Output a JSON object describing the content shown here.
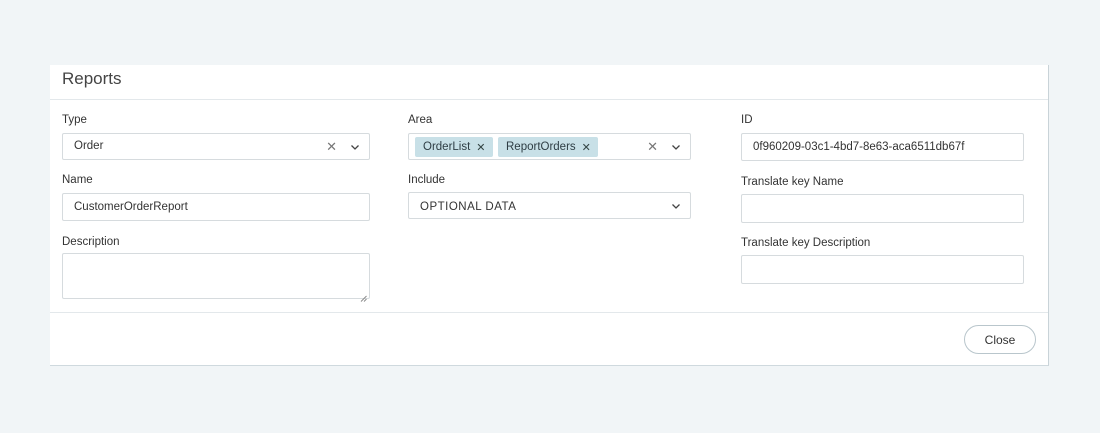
{
  "dialog": {
    "title": "Reports",
    "close_label": "Close"
  },
  "form": {
    "type": {
      "label": "Type",
      "value": "Order"
    },
    "area": {
      "label": "Area",
      "tags": [
        "OrderList",
        "ReportOrders"
      ]
    },
    "id": {
      "label": "ID",
      "value": "0f960209-03c1-4bd7-8e63-aca6511db67f"
    },
    "name": {
      "label": "Name",
      "value": "CustomerOrderReport"
    },
    "include": {
      "label": "Include",
      "placeholder": "OPTIONAL DATA"
    },
    "translate_key_name": {
      "label": "Translate key Name",
      "value": ""
    },
    "description": {
      "label": "Description",
      "value": ""
    },
    "translate_key_description": {
      "label": "Translate key Description",
      "value": ""
    }
  },
  "icons": {
    "clear": "close-icon",
    "dropdown": "chevron-down-icon",
    "tag_remove": "close-icon",
    "resize": "resize-grip-icon"
  },
  "colors": {
    "page_background": "#f1f5f7",
    "tag_background": "#c8e0e7",
    "border": "#d6dbde"
  }
}
